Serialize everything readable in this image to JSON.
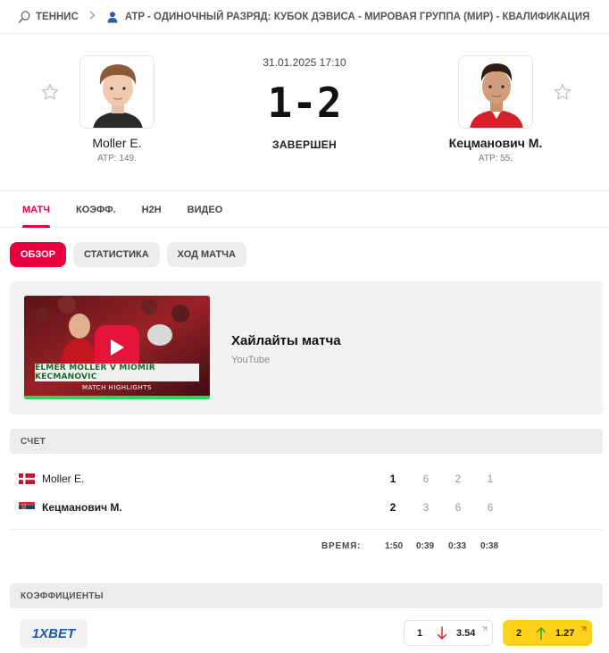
{
  "breadcrumb": {
    "sport": "ТЕННИС",
    "tournament": "ATP - ОДИНОЧНЫЙ РАЗРЯД: КУБОК ДЭВИСА - МИРОВАЯ ГРУППА (МИР) - КВАЛИФИКАЦИЯ",
    "icons": [
      "tennis-racket-icon",
      "chevron-right-icon",
      "person-icon"
    ]
  },
  "match": {
    "date": "31.01.2025 17:10",
    "score": "1-2",
    "status": "ЗАВЕРШЕН",
    "home": {
      "name": "Moller E.",
      "rank": "ATP: 149."
    },
    "away": {
      "name": "Кецманович М.",
      "rank": "ATP: 55."
    }
  },
  "tabs": [
    "МАТЧ",
    "КОЭФФ.",
    "H2H",
    "ВИДЕО"
  ],
  "subtabs": [
    "ОБЗОР",
    "СТАТИСТИКА",
    "ХОД МАТЧА"
  ],
  "highlights": {
    "title": "Хайлайты матча",
    "source": "YouTube",
    "thumb_caption": "ELMER MOLLER V MIOMIR KECMANOVIC",
    "thumb_sub": "MATCH HIGHLIGHTS"
  },
  "score_section": {
    "title": "СЧЕТ",
    "rows": [
      {
        "name": "Moller E.",
        "total": "1",
        "sets": [
          "6",
          "2",
          "1"
        ]
      },
      {
        "name": "Кецманович М.",
        "total": "2",
        "sets": [
          "3",
          "6",
          "6"
        ]
      }
    ],
    "time_label": "ВРЕМЯ:",
    "times": [
      "1:50",
      "0:39",
      "0:33",
      "0:38"
    ]
  },
  "odds_section": {
    "title": "КОЭФФИЦИЕНТЫ",
    "bookmaker": "1XBET",
    "odds": [
      {
        "label": "1",
        "value": "3.54",
        "direction": "down"
      },
      {
        "label": "2",
        "value": "1.27",
        "direction": "up"
      }
    ]
  },
  "colors": {
    "accent": "#e6003e",
    "highlight": "#ffd11a",
    "down": "#d62828",
    "up": "#3aa52f"
  }
}
